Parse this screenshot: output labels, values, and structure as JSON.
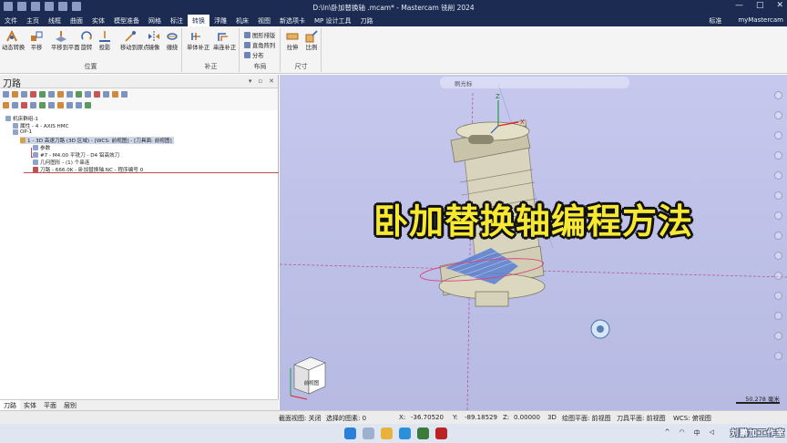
{
  "window": {
    "title": "D:\\ln\\卧加替换轴 .mcam* - Mastercam 铣削 2024",
    "controls": [
      "—",
      "□",
      "✕"
    ]
  },
  "menu": {
    "tabs": [
      "文件",
      "主页",
      "线框",
      "曲面",
      "实体",
      "模型准备",
      "网格",
      "标注",
      "转换",
      "浮雕",
      "机床",
      "视图",
      "新选项卡",
      "MP 设计工具",
      "刀路"
    ],
    "active_tab": "转换",
    "right_items": [
      "标准",
      "myMastercam"
    ]
  },
  "ribbon": {
    "position_buttons": [
      "动态转换",
      "平移",
      "平移到平面",
      "旋转",
      "投影",
      "移动到原点",
      "镜像",
      "缠绕"
    ],
    "position_label": "位置",
    "offset_buttons": [
      "单体补正",
      "串连补正"
    ],
    "offset_label": "补正",
    "layout_items": [
      "图形排版",
      "直角阵列",
      "分布"
    ],
    "layout_label": "布局",
    "size_buttons": [
      "拉伸",
      "比例"
    ],
    "size_label": "尺寸"
  },
  "panel": {
    "title": "刀路",
    "controls": [
      "▾",
      "▫",
      "✕"
    ],
    "tree": {
      "machine_group": "机床群组-1",
      "properties": "属性 - 4 - AXIS HMC",
      "op_group": "OP-1",
      "operation": "1 - 3D 高速刀路 (3D 区域) - [WCS: 前视图] - [刀具面: 前视图]",
      "params": "参数",
      "tool": "#7 - M4.00 平铣刀 - D4 铝高效刀",
      "geometry": "几何图形 - (1) 个串连",
      "toolpath": "刀路 - 666.0K - 卧加替换轴.NC - 程序编号 0"
    },
    "bottom_tabs": [
      "刀路",
      "实体",
      "平面",
      "层别"
    ],
    "active_bottom_tab": "刀路"
  },
  "viewport": {
    "toolbar_text": "刷光标",
    "overlay_title": "卧加替换轴编程方法",
    "axis_z": "Z",
    "axis_x": "X",
    "scale_text": "50.278 毫米",
    "cube_label": "前视图"
  },
  "status": {
    "section_view": "截面视图: 关闭",
    "selected": "选择的图素: 0",
    "x_label": "X:",
    "x_value": "-36.70520",
    "y_label": "Y:",
    "y_value": "-89.18529",
    "z_label": "Z:",
    "z_value": "0.00000",
    "mode": "3D",
    "draw_plane": "绘图平面: 前视图",
    "tool_plane": "刀具平面: 前视图",
    "wcs": "WCS: 俯视图"
  },
  "taskbar": {
    "ime": "中",
    "watermark": "刘鹏加工作室"
  },
  "colors": {
    "title_bar": "#1b2b52",
    "overlay_text": "#f7e832",
    "viewport_bg": "#c3c5ec"
  }
}
